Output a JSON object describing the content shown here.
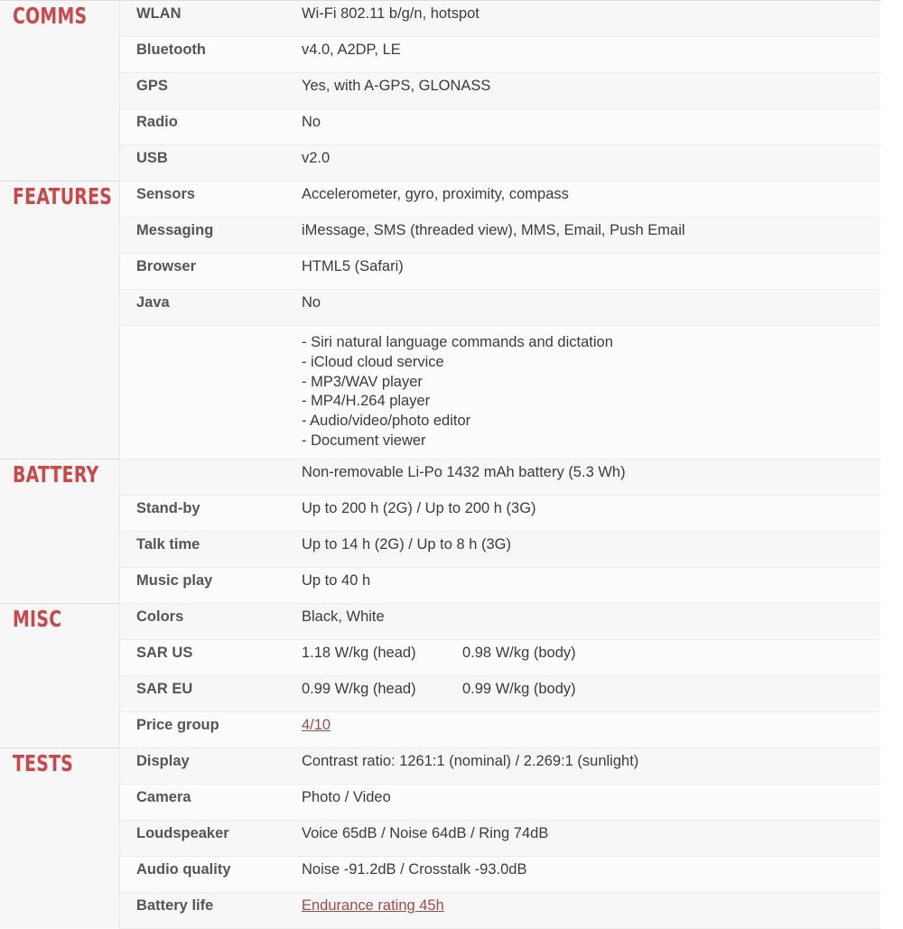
{
  "colors": {
    "section_header": "#cc4747",
    "label_text": "#555555",
    "value_text": "#3b3b3b",
    "link": "#9c4b4b",
    "row_bg": "#f7f7f7",
    "row_bg_alt": "#fcfcfc",
    "row_border": "#ececec",
    "section_border": "#dcdcdc"
  },
  "sections": [
    {
      "title": "COMMS",
      "rows": [
        {
          "label": "WLAN",
          "value": "Wi-Fi 802.11 b/g/n, hotspot"
        },
        {
          "label": "Bluetooth",
          "value": "v4.0, A2DP, LE"
        },
        {
          "label": "GPS",
          "value": "Yes, with A-GPS, GLONASS"
        },
        {
          "label": "Radio",
          "value": "No"
        },
        {
          "label": "USB",
          "value": "v2.0"
        }
      ]
    },
    {
      "title": "FEATURES",
      "rows": [
        {
          "label": "Sensors",
          "value": "Accelerometer, gyro, proximity, compass"
        },
        {
          "label": "Messaging",
          "value": "iMessage, SMS (threaded view), MMS, Email, Push Email"
        },
        {
          "label": "Browser",
          "value": "HTML5 (Safari)"
        },
        {
          "label": "Java",
          "value": "No"
        },
        {
          "label": "",
          "value": "- Siri natural language commands and dictation\n- iCloud cloud service\n- MP3/WAV player\n- MP4/H.264 player\n- Audio/video/photo editor\n- Document viewer"
        }
      ]
    },
    {
      "title": "BATTERY",
      "rows": [
        {
          "label": "",
          "value": "Non-removable Li-Po 1432 mAh battery (5.3 Wh)"
        },
        {
          "label": "Stand-by",
          "value": "Up to 200 h (2G) / Up to 200 h (3G)"
        },
        {
          "label": "Talk time",
          "value": "Up to 14 h (2G) / Up to 8 h (3G)"
        },
        {
          "label": "Music play",
          "value": "Up to 40 h"
        }
      ]
    },
    {
      "title": "MISC",
      "rows": [
        {
          "label": "Colors",
          "value": "Black, White"
        },
        {
          "label": "SAR US",
          "value_a": "1.18 W/kg (head)",
          "value_b": "0.98 W/kg (body)"
        },
        {
          "label": "SAR EU",
          "value_a": "0.99 W/kg (head)",
          "value_b": "0.99 W/kg (body)"
        },
        {
          "label": "Price group",
          "value": "4/10",
          "link": true
        }
      ]
    },
    {
      "title": "TESTS",
      "rows": [
        {
          "label": "Display",
          "value": "Contrast ratio: 1261:1 (nominal) / 2.269:1 (sunlight)"
        },
        {
          "label": "Camera",
          "value": "Photo / Video"
        },
        {
          "label": "Loudspeaker",
          "value": "Voice 65dB / Noise 64dB / Ring 74dB"
        },
        {
          "label": "Audio quality",
          "value": "Noise -91.2dB / Crosstalk -93.0dB"
        },
        {
          "label": "Battery life",
          "value": "Endurance rating 45h",
          "link": true
        }
      ]
    }
  ]
}
